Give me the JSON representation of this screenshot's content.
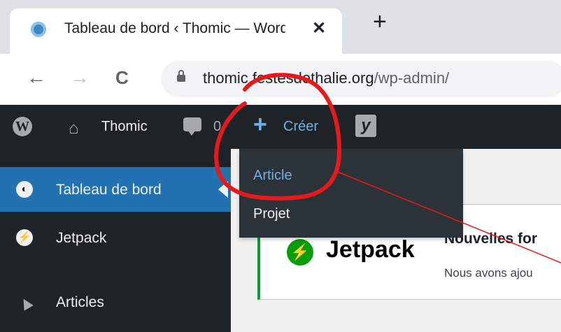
{
  "browser": {
    "tab": {
      "title": "Tableau de bord ‹ Thomic — WordPress",
      "favicon": "wordpress-favicon-icon",
      "close_glyph": "✕"
    },
    "new_tab_glyph": "+",
    "nav": {
      "back_glyph": "←",
      "forward_glyph": "→",
      "reload_glyph": "C"
    },
    "url": {
      "host": "thomic.festesdethalie.org",
      "path": "/wp-admin/"
    }
  },
  "adminbar": {
    "wp_logo": "W",
    "site_name": "Thomic",
    "comments_count": "0",
    "create_label": "Créer",
    "create_plus": "+",
    "yoast_glyph": "y"
  },
  "create_menu": {
    "items": [
      {
        "label": "Article"
      },
      {
        "label": "Projet"
      }
    ]
  },
  "sidebar": {
    "items": [
      {
        "label": "Tableau de bord",
        "icon": "dashboard-icon",
        "active": true
      },
      {
        "label": "Jetpack",
        "icon": "jetpack-icon"
      },
      {
        "label": "Articles",
        "icon": "pin-icon"
      }
    ]
  },
  "notice": {
    "brand": "Jetpack",
    "brand_glyph": "⚡",
    "title": "Nouvelles for",
    "text": "Nous avons ajou"
  },
  "annotation": {
    "color": "#e8191c"
  },
  "colors": {
    "adminbar": "#1d2327",
    "sidebar_active": "#2271b1",
    "menu_link": "#72aee6",
    "jetpack_green": "#069e08"
  }
}
